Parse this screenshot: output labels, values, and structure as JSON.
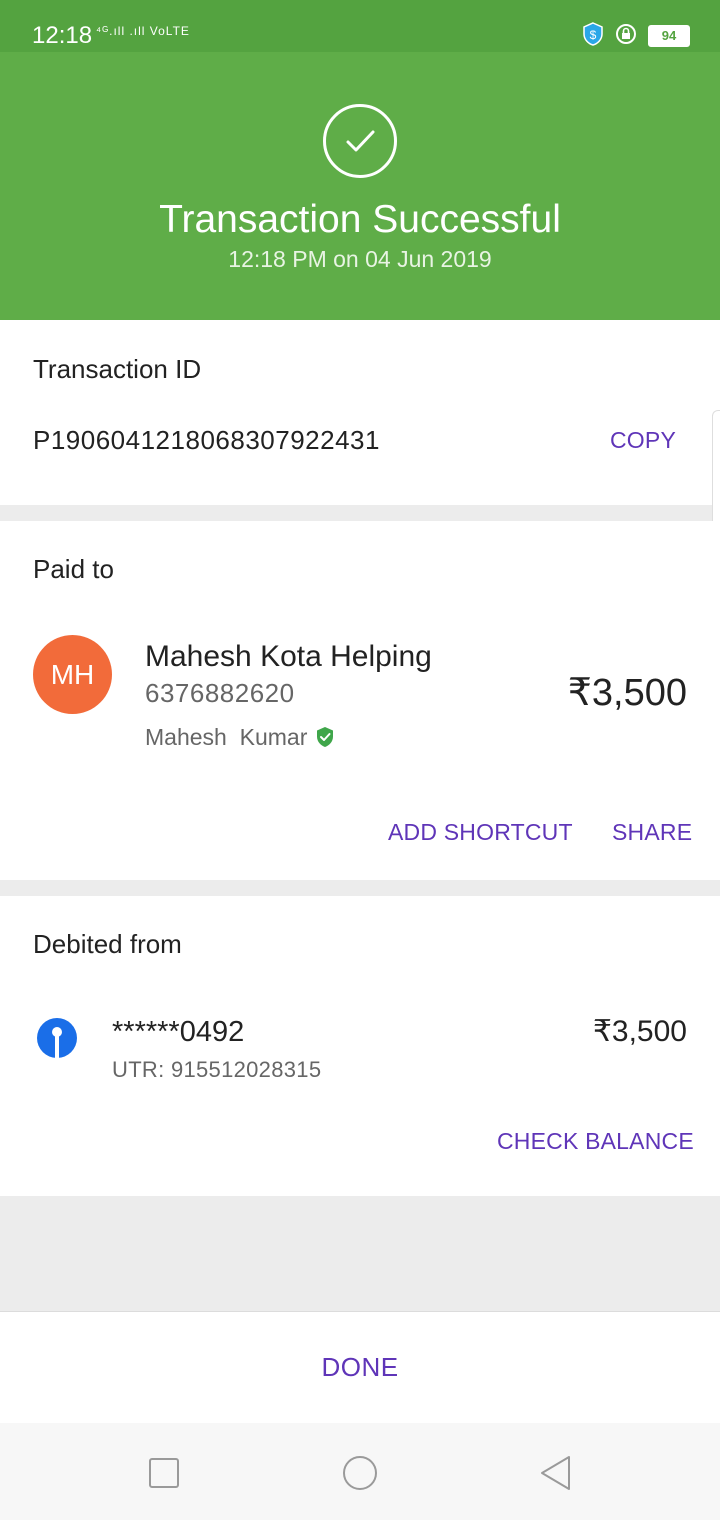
{
  "status_bar": {
    "time": "12:18",
    "signal_text": "⁴ᴳ.ıll .ıll VoLTE",
    "battery": "94"
  },
  "header": {
    "title": "Transaction Successful",
    "subtitle": "12:18 PM on 04 Jun 2019",
    "background_color": "#5fad48",
    "icon": "check-circle-icon"
  },
  "transaction": {
    "label": "Transaction ID",
    "id": "P1906041218068307922431",
    "copy_label": "COPY"
  },
  "paid_to": {
    "label": "Paid to",
    "avatar_initials": "MH",
    "avatar_color": "#f26b3a",
    "name": "Mahesh Kota Helping",
    "phone": "6376882620",
    "verified_name": "Mahesh  Kumar",
    "amount": "₹3,500",
    "add_shortcut_label": "ADD SHORTCUT",
    "share_label": "SHARE"
  },
  "debited_from": {
    "label": "Debited from",
    "bank_icon": "bank-logo-icon",
    "account": "******0492",
    "utr": "UTR: 915512028315",
    "amount": "₹3,500",
    "check_balance_label": "CHECK BALANCE"
  },
  "footer": {
    "done_label": "DONE"
  },
  "accent_color": "#5f35b8"
}
